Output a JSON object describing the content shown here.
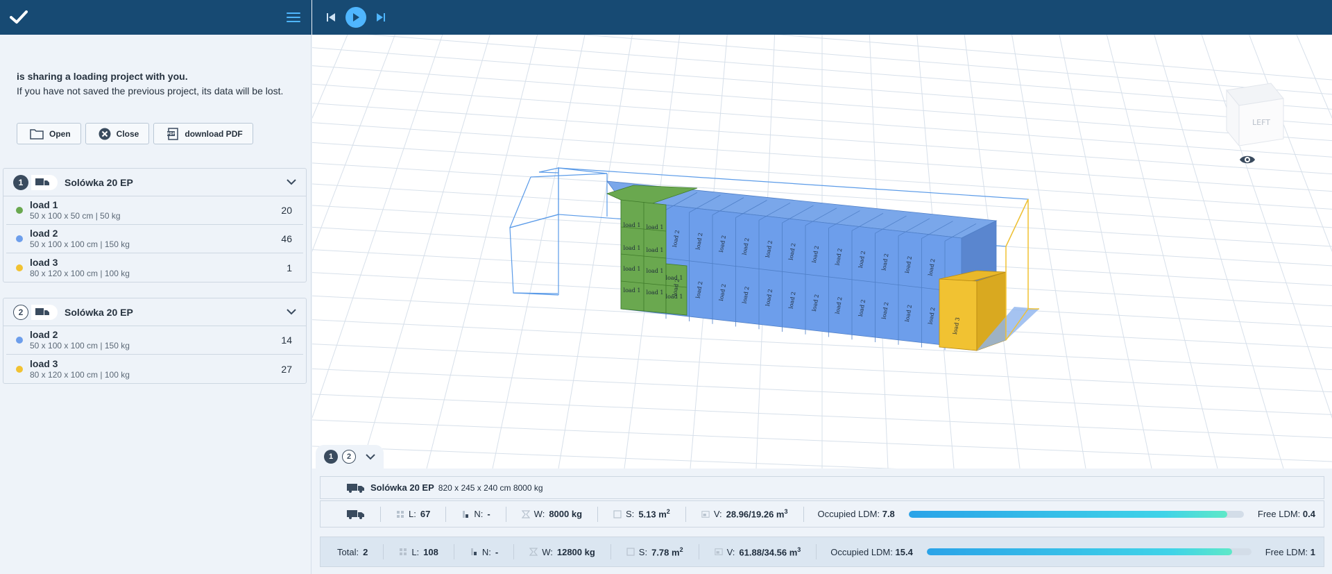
{
  "app": {
    "colors": {
      "topbar": "#174a73",
      "accent": "#4fb6ff",
      "green": "#6aa84f",
      "blue": "#6d9eeb",
      "yellow": "#f1c232"
    }
  },
  "share": {
    "line1": "is sharing a loading project with you.",
    "line2": "If you have not saved the previous project, its data will be lost."
  },
  "actions": {
    "open": "Open",
    "close": "Close",
    "pdf": "download PDF"
  },
  "vehicles": [
    {
      "number": "1",
      "name": "Solówka 20 EP",
      "loads": [
        {
          "name": "load 1",
          "spec": "50 x 100 x 50 cm | 50 kg",
          "qty": "20",
          "color": "#6aa84f"
        },
        {
          "name": "load 2",
          "spec": "50 x 100 x 100 cm | 150 kg",
          "qty": "46",
          "color": "#6d9eeb"
        },
        {
          "name": "load 3",
          "spec": "80 x 120 x 100 cm | 100 kg",
          "qty": "1",
          "color": "#f1c232"
        }
      ]
    },
    {
      "number": "2",
      "name": "Solówka 20 EP",
      "loads": [
        {
          "name": "load 2",
          "spec": "50 x 100 x 100 cm | 150 kg",
          "qty": "14",
          "color": "#6d9eeb"
        },
        {
          "name": "load 3",
          "spec": "80 x 120 x 100 cm | 100 kg",
          "qty": "27",
          "color": "#f1c232"
        }
      ]
    }
  ],
  "viewcube": {
    "label": "LEFT"
  },
  "scene_labels": {
    "load1": "load 1",
    "load2": "load 2",
    "load3": "load 3"
  },
  "tabs": [
    "1",
    "2"
  ],
  "vehicle_info": {
    "name": "Solówka 20 EP",
    "dims": "820 x 245 x 240 cm 8000 kg"
  },
  "vehicle_stats": {
    "l_label": "L:",
    "l": "67",
    "n_label": "N:",
    "n": "-",
    "w_label": "W:",
    "w": "8000 kg",
    "s_label": "S:",
    "s": "5.13 m",
    "v_label": "V:",
    "v": "28.96/19.26 m",
    "occ_label": "Occupied LDM:",
    "occ": "7.8",
    "occ_fraction": 0.95,
    "free_label": "Free LDM:",
    "free": "0.4"
  },
  "total_stats": {
    "total_label": "Total:",
    "total": "2",
    "l_label": "L:",
    "l": "108",
    "n_label": "N:",
    "n": "-",
    "w_label": "W:",
    "w": "12800 kg",
    "s_label": "S:",
    "s": "7.78 m",
    "v_label": "V:",
    "v": "61.88/34.56 m",
    "occ_label": "Occupied LDM:",
    "occ": "15.4",
    "occ_fraction": 0.94,
    "free_label": "Free LDM:",
    "free": "1"
  },
  "units": {
    "sq": "2",
    "cube": "3"
  }
}
